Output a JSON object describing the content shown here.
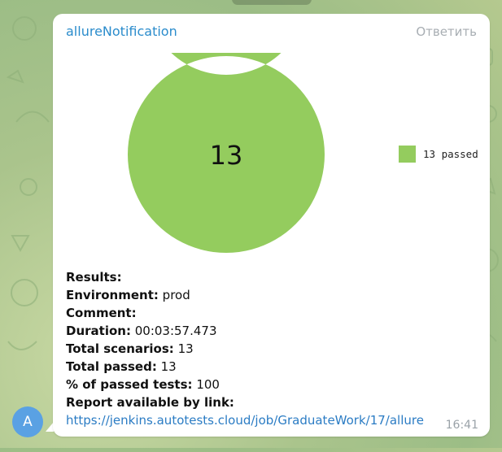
{
  "message": {
    "sender": "allureNotification",
    "reply_label": "Ответить",
    "time": "16:41"
  },
  "avatar": {
    "initial": "A",
    "color": "#5aa1e3"
  },
  "chart_data": {
    "type": "pie",
    "style": "donut",
    "center_label": "13",
    "categories": [
      "13 passed"
    ],
    "values": [
      13
    ],
    "colors": [
      "#94cc5e"
    ],
    "legend": "right"
  },
  "report": {
    "results_label": "Results:",
    "environment_label": "Environment:",
    "environment_value": "prod",
    "comment_label": "Comment:",
    "duration_label": "Duration:",
    "duration_value": "00:03:57.473",
    "total_scenarios_label": "Total scenarios:",
    "total_scenarios_value": "13",
    "total_passed_label": "Total passed:",
    "total_passed_value": "13",
    "percent_passed_label": "% of passed tests:",
    "percent_passed_value": "100",
    "report_link_label": "Report available by link:",
    "report_link": "https://jenkins.autotests.cloud/job/GraduateWork/17/allure"
  }
}
